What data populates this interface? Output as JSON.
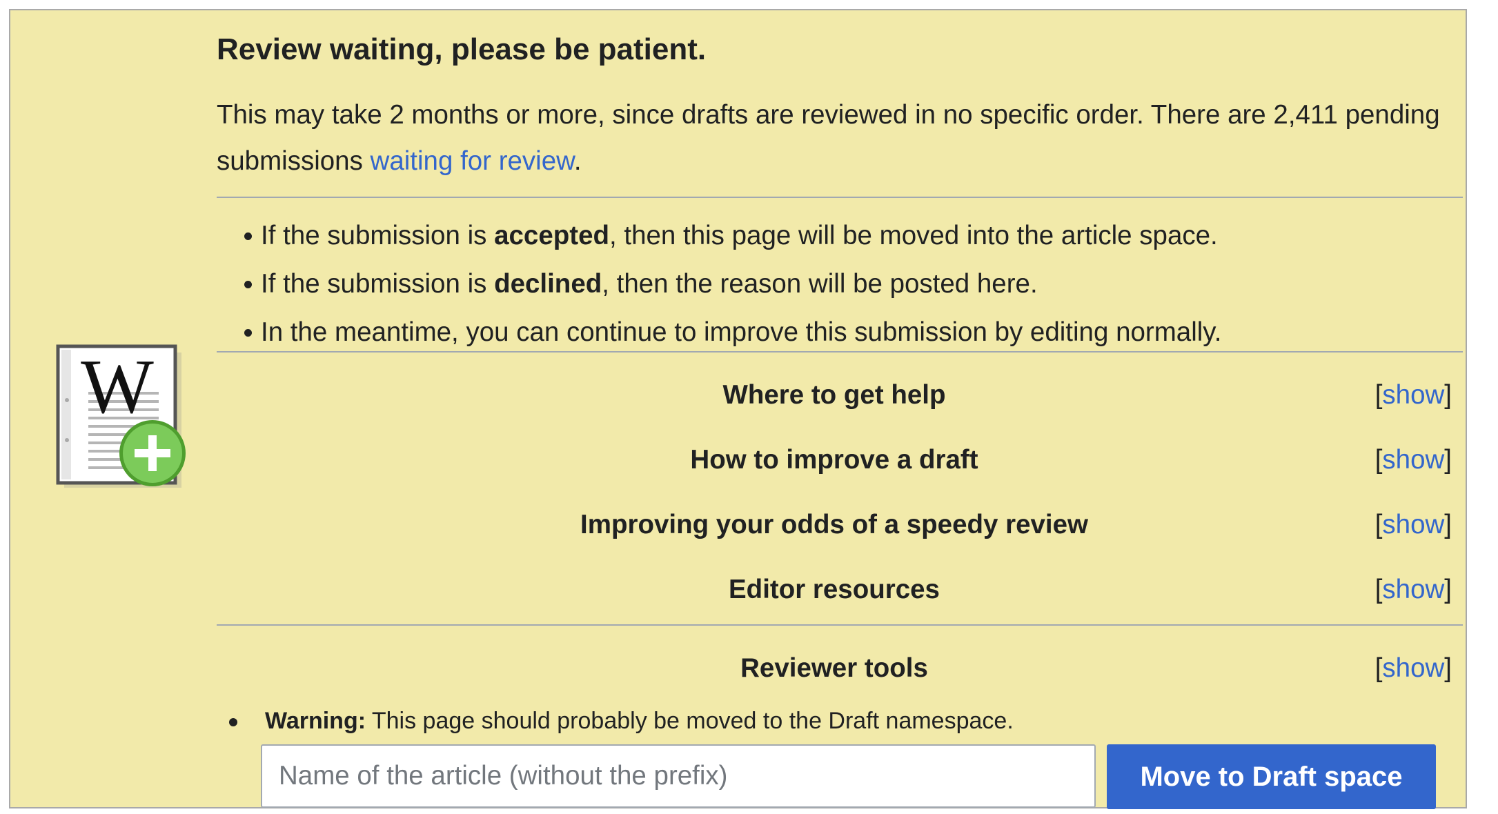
{
  "header": {
    "title": "Review waiting, please be patient."
  },
  "intro": {
    "text_before": "This may take 2 months or more, since drafts are reviewed in no specific order. There are 2,411 pending submissions ",
    "link_text": "waiting for review",
    "text_after": "."
  },
  "bullets": [
    {
      "prefix": "If the submission is ",
      "bold": "accepted",
      "suffix": ", then this page will be moved into the article space."
    },
    {
      "prefix": "If the submission is ",
      "bold": "declined",
      "suffix": ", then the reason will be posted here."
    },
    {
      "prefix": "In the meantime, you can continue to improve this submission by editing normally.",
      "bold": "",
      "suffix": ""
    }
  ],
  "sections": [
    {
      "title": "Where to get help",
      "toggle": "show"
    },
    {
      "title": "How to improve a draft",
      "toggle": "show"
    },
    {
      "title": "Improving your odds of a speedy review",
      "toggle": "show"
    },
    {
      "title": "Editor resources",
      "toggle": "show"
    }
  ],
  "reviewer": {
    "title": "Reviewer tools",
    "toggle": "show"
  },
  "toggle_brackets": {
    "open": "[",
    "close": "]"
  },
  "warning": {
    "label": "Warning:",
    "text": " This page should probably be moved to the Draft namespace."
  },
  "move_form": {
    "placeholder": "Name of the article (without the prefix)",
    "value": "",
    "button_label": "Move to Draft space"
  },
  "icons": {
    "logo": "wikipedia-add-page-icon"
  },
  "colors": {
    "background": "#f2eaaa",
    "link": "#3366cc",
    "button": "#3366cc"
  }
}
